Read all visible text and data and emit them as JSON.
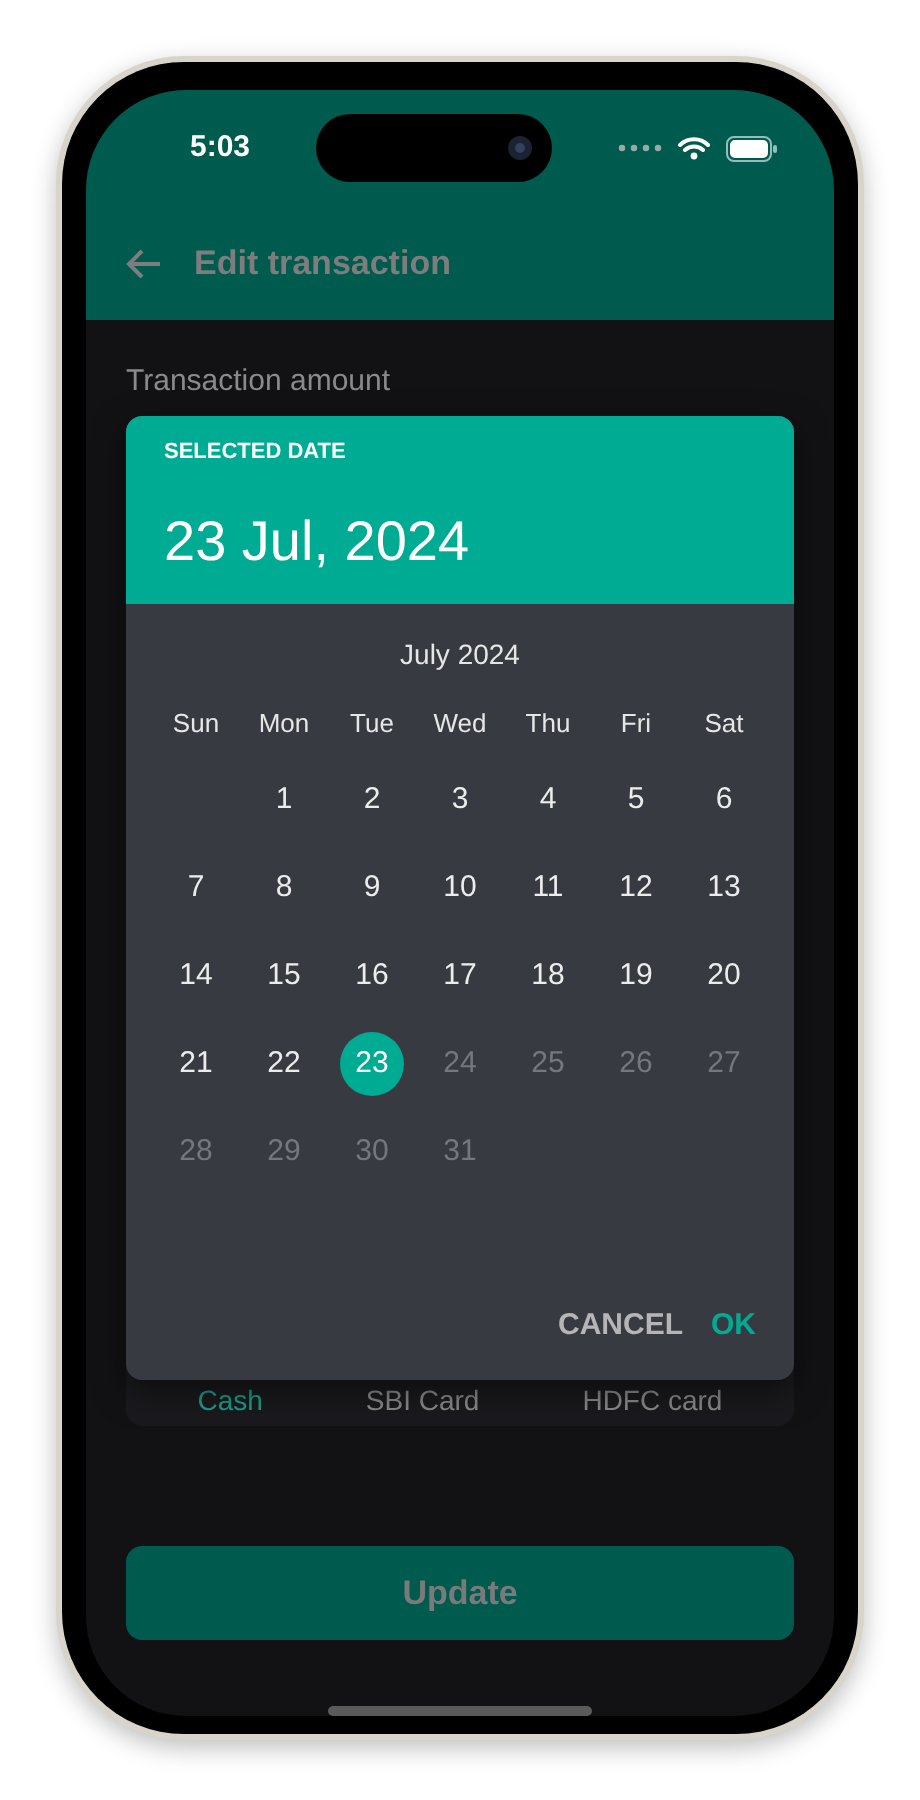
{
  "status_bar": {
    "time": "5:03"
  },
  "app_bar": {
    "title": "Edit transaction"
  },
  "form": {
    "amount_label": "Transaction amount",
    "accounts": [
      {
        "label": "Cash",
        "selected": true
      },
      {
        "label": "SBI Card",
        "selected": false
      },
      {
        "label": "HDFC card",
        "selected": false
      }
    ]
  },
  "date_picker": {
    "header_label": "SELECTED DATE",
    "selected_date": "23 Jul, 2024",
    "month": "July 2024",
    "weekdays": [
      "Sun",
      "Mon",
      "Tue",
      "Wed",
      "Thu",
      "Fri",
      "Sat"
    ],
    "weeks": [
      [
        {
          "kind": "blank"
        },
        {
          "kind": "day",
          "label": "1",
          "selected": false,
          "disabled": false
        },
        {
          "kind": "day",
          "label": "2",
          "selected": false,
          "disabled": false
        },
        {
          "kind": "day",
          "label": "3",
          "selected": false,
          "disabled": false
        },
        {
          "kind": "day",
          "label": "4",
          "selected": false,
          "disabled": false
        },
        {
          "kind": "day",
          "label": "5",
          "selected": false,
          "disabled": false
        },
        {
          "kind": "day",
          "label": "6",
          "selected": false,
          "disabled": false
        }
      ],
      [
        {
          "kind": "day",
          "label": "7",
          "selected": false,
          "disabled": false
        },
        {
          "kind": "day",
          "label": "8",
          "selected": false,
          "disabled": false
        },
        {
          "kind": "day",
          "label": "9",
          "selected": false,
          "disabled": false
        },
        {
          "kind": "day",
          "label": "10",
          "selected": false,
          "disabled": false
        },
        {
          "kind": "day",
          "label": "11",
          "selected": false,
          "disabled": false
        },
        {
          "kind": "day",
          "label": "12",
          "selected": false,
          "disabled": false
        },
        {
          "kind": "day",
          "label": "13",
          "selected": false,
          "disabled": false
        }
      ],
      [
        {
          "kind": "day",
          "label": "14",
          "selected": false,
          "disabled": false
        },
        {
          "kind": "day",
          "label": "15",
          "selected": false,
          "disabled": false
        },
        {
          "kind": "day",
          "label": "16",
          "selected": false,
          "disabled": false
        },
        {
          "kind": "day",
          "label": "17",
          "selected": false,
          "disabled": false
        },
        {
          "kind": "day",
          "label": "18",
          "selected": false,
          "disabled": false
        },
        {
          "kind": "day",
          "label": "19",
          "selected": false,
          "disabled": false
        },
        {
          "kind": "day",
          "label": "20",
          "selected": false,
          "disabled": false
        }
      ],
      [
        {
          "kind": "day",
          "label": "21",
          "selected": false,
          "disabled": false
        },
        {
          "kind": "day",
          "label": "22",
          "selected": false,
          "disabled": false
        },
        {
          "kind": "day",
          "label": "23",
          "selected": true,
          "disabled": false
        },
        {
          "kind": "day",
          "label": "24",
          "selected": false,
          "disabled": true
        },
        {
          "kind": "day",
          "label": "25",
          "selected": false,
          "disabled": true
        },
        {
          "kind": "day",
          "label": "26",
          "selected": false,
          "disabled": true
        },
        {
          "kind": "day",
          "label": "27",
          "selected": false,
          "disabled": true
        }
      ],
      [
        {
          "kind": "day",
          "label": "28",
          "selected": false,
          "disabled": true
        },
        {
          "kind": "day",
          "label": "29",
          "selected": false,
          "disabled": true
        },
        {
          "kind": "day",
          "label": "30",
          "selected": false,
          "disabled": true
        },
        {
          "kind": "day",
          "label": "31",
          "selected": false,
          "disabled": true
        }
      ]
    ],
    "buttons": [
      {
        "label": "CANCEL",
        "kind": "cancel"
      },
      {
        "label": "OK",
        "kind": "confirm"
      }
    ]
  },
  "update_button": {
    "label": "Update",
    "disabled": true
  }
}
